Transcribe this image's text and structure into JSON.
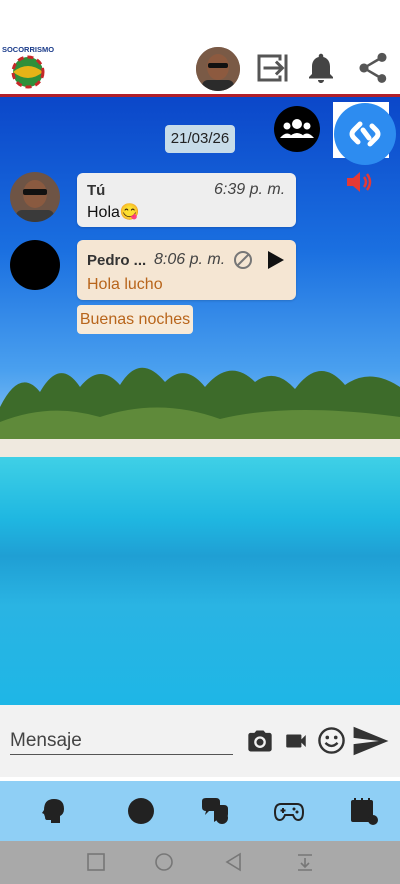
{
  "header": {
    "logo_text": "SOCORRISMO",
    "icons": [
      "profile-avatar",
      "logout-icon",
      "bell-icon",
      "share-icon"
    ]
  },
  "chat": {
    "date": "21/03/26",
    "messages": [
      {
        "sender": "Tú",
        "time": "6:39 p. m.",
        "text": "Hola😋"
      },
      {
        "sender": "Pedro ...",
        "time": "8:06 p. m.",
        "text": "Hola lucho"
      }
    ],
    "reply_chip": "Buenas noches"
  },
  "composer": {
    "placeholder": "Mensaje"
  },
  "tabs": [
    "head-icon",
    "circle-icon",
    "chat-bubbles-icon",
    "gamepad-icon",
    "notes-icon"
  ],
  "system_nav": [
    "recent-apps-icon",
    "home-icon",
    "back-icon",
    "notification-down-icon"
  ],
  "colors": {
    "accent_red": "#b0202a",
    "tab_bar": "#8fcff5",
    "shazam_blue": "#2d8cf0"
  }
}
